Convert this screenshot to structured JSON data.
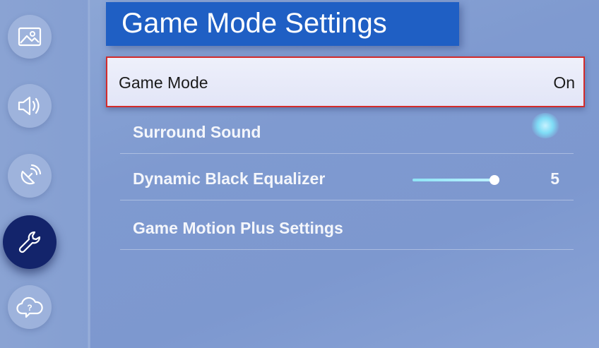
{
  "page": {
    "title": "Game Mode Settings"
  },
  "sidebar": {
    "items": [
      {
        "name": "picture",
        "icon": "picture-icon"
      },
      {
        "name": "sound",
        "icon": "speaker-icon"
      },
      {
        "name": "broadcasting",
        "icon": "satellite-dish-icon"
      },
      {
        "name": "general",
        "icon": "wrench-icon",
        "active": true
      },
      {
        "name": "support",
        "icon": "cloud-question-icon"
      }
    ]
  },
  "settings": {
    "game_mode": {
      "label": "Game Mode",
      "value": "On"
    },
    "surround_sound": {
      "label": "Surround Sound"
    },
    "dynamic_black_equalizer": {
      "label": "Dynamic Black Equalizer",
      "value": "5",
      "slider_level": 1.0
    },
    "game_motion_plus": {
      "label": "Game Motion Plus Settings"
    }
  },
  "colors": {
    "title_bar": "#1f5fc4",
    "focus_border": "#d22b2b",
    "active_nav": "#13246b",
    "slider_fill": "#8fe4f6"
  }
}
